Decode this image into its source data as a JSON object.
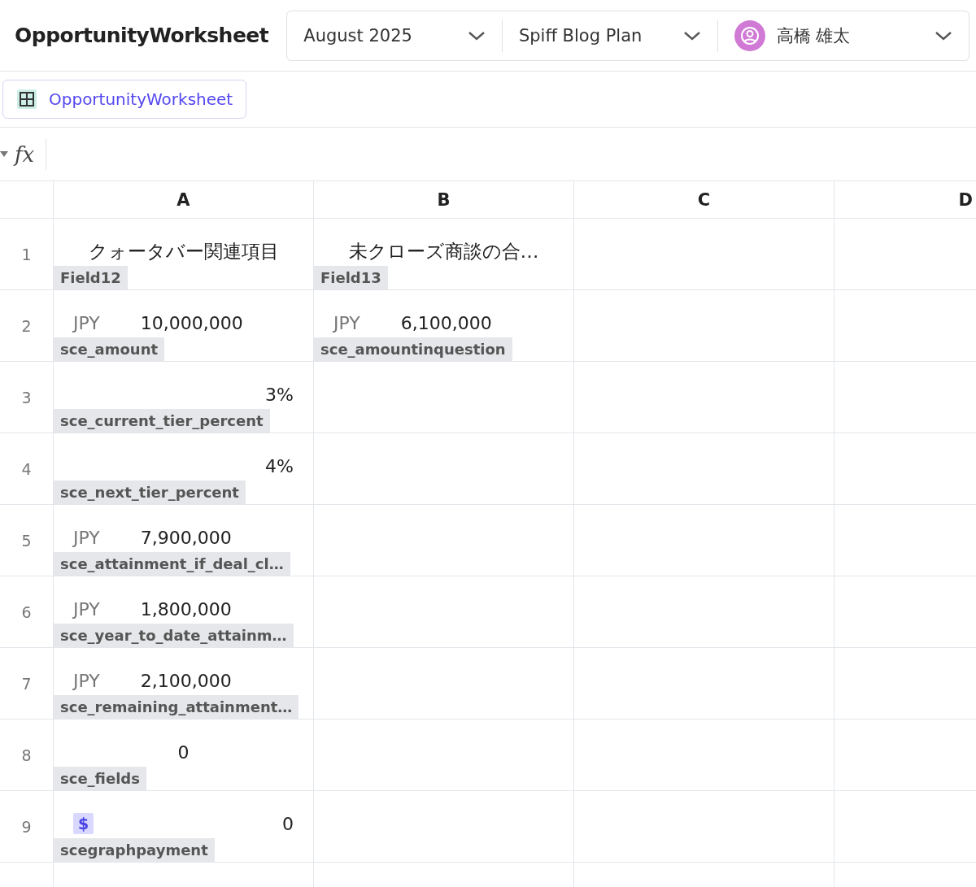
{
  "app_title": "OpportunityWorksheet",
  "selectors": [
    {
      "kind": "plain",
      "label": "August 2025"
    },
    {
      "kind": "plain",
      "label": "Spiff Blog Plan"
    },
    {
      "kind": "user",
      "label": "高橋 雄太"
    }
  ],
  "sheet_tab": {
    "label": "OpportunityWorksheet"
  },
  "formula_bar": {
    "label": "fx"
  },
  "table": {
    "columns": [
      "A",
      "B",
      "C",
      "D"
    ],
    "rows": [
      {
        "number": "1",
        "cells": [
          {
            "kind": "text",
            "value": "クォータバー関連項目",
            "tag": "Field12"
          },
          {
            "kind": "text",
            "value": "未クローズ商談の合…",
            "tag": "Field13"
          }
        ]
      },
      {
        "number": "2",
        "cells": [
          {
            "kind": "currency",
            "currency": "JPY",
            "value": "10,000,000",
            "tag": "sce_amount"
          },
          {
            "kind": "currency",
            "currency": "JPY",
            "value": "6,100,000",
            "tag": "sce_amountinquestion"
          }
        ]
      },
      {
        "number": "3",
        "cells": [
          {
            "kind": "right",
            "value": "3%",
            "tag": "sce_current_tier_percent"
          }
        ]
      },
      {
        "number": "4",
        "cells": [
          {
            "kind": "right",
            "value": "4%",
            "tag": "sce_next_tier_percent"
          }
        ]
      },
      {
        "number": "5",
        "cells": [
          {
            "kind": "currency",
            "currency": "JPY",
            "value": "7,900,000",
            "tag": "sce_attainment_if_deal_cl…"
          }
        ]
      },
      {
        "number": "6",
        "cells": [
          {
            "kind": "currency",
            "currency": "JPY",
            "value": "1,800,000",
            "tag": "sce_year_to_date_attainm…"
          }
        ]
      },
      {
        "number": "7",
        "cells": [
          {
            "kind": "currency",
            "currency": "JPY",
            "value": "2,100,000",
            "tag": "sce_remaining_attainment…"
          }
        ]
      },
      {
        "number": "8",
        "cells": [
          {
            "kind": "center",
            "value": "0",
            "tag": "sce_fields"
          }
        ]
      },
      {
        "number": "9",
        "cells": [
          {
            "kind": "payment",
            "icon": "$",
            "value": "0",
            "tag": "scegraphpayment"
          }
        ]
      }
    ]
  }
}
